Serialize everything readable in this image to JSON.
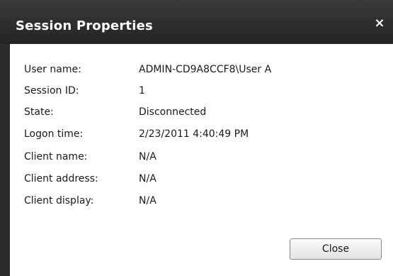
{
  "dialog": {
    "title": "Session Properties",
    "close_glyph": "×",
    "close_icon": "close-icon"
  },
  "properties": [
    {
      "label": "User name:",
      "value": "ADMIN-CD9A8CCF8\\User A"
    },
    {
      "label": "Session ID:",
      "value": "1"
    },
    {
      "label": "State:",
      "value": "Disconnected"
    },
    {
      "label": "Logon time:",
      "value": "2/23/2011 4:40:49 PM"
    },
    {
      "label": "Client name:",
      "value": "N/A"
    },
    {
      "label": "Client address:",
      "value": "N/A"
    },
    {
      "label": "Client display:",
      "value": "N/A"
    }
  ],
  "buttons": {
    "close_label": "Close"
  },
  "colors": {
    "titlebar": "#2b2b2b",
    "title_text": "#ffffff",
    "content_bg": "#ffffff",
    "text": "#1a1a1a"
  }
}
